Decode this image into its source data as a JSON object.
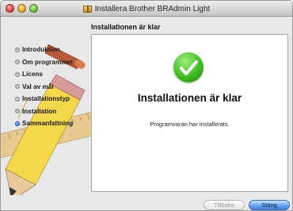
{
  "window": {
    "title": "Installera Brother BRAdmin Light"
  },
  "header": {
    "heading": "Installationen är klar"
  },
  "sidebar": {
    "steps": [
      {
        "label": "Introduktion"
      },
      {
        "label": "Om programmet"
      },
      {
        "label": "Licens"
      },
      {
        "label": "Val av mål"
      },
      {
        "label": "Installationstyp"
      },
      {
        "label": "Installation"
      },
      {
        "label": "Sammanfattning"
      }
    ]
  },
  "main": {
    "title": "Installationen är klar",
    "message": "Programvaran har installerats."
  },
  "buttons": {
    "back_label": "Tillbaka",
    "close_label": "Stäng"
  },
  "colors": {
    "accent": "#3b82e0",
    "success": "#3fbd21"
  }
}
